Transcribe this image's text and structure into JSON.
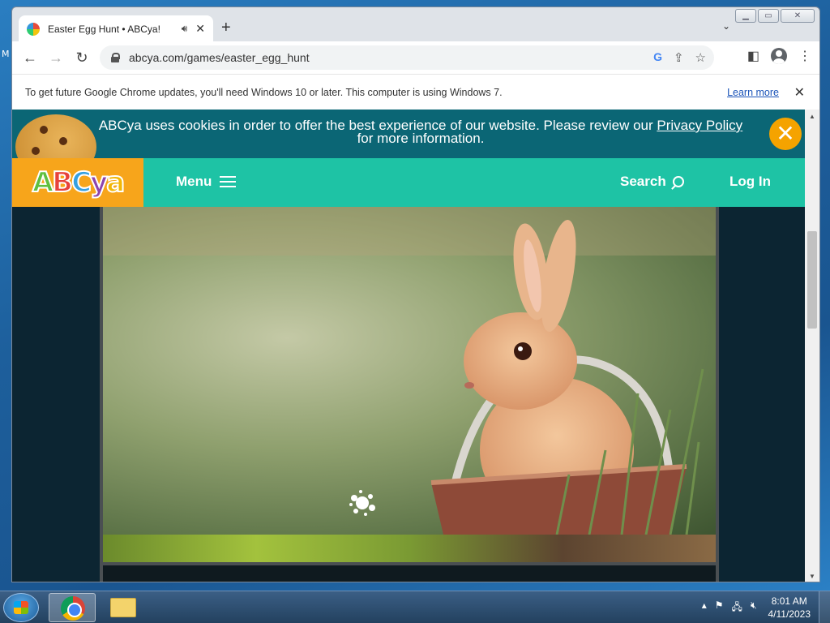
{
  "browser": {
    "tab_title": "Easter Egg Hunt • ABCya!",
    "url": "abcya.com/games/easter_egg_hunt",
    "infobar_text": "To get future Google Chrome updates, you'll need Windows 10 or later. This computer is using Windows 7.",
    "learn_more": "Learn more"
  },
  "site": {
    "cookie_text_1": "ABCya uses cookies in order to offer the best experience of our website. Please review our ",
    "cookie_link": "Privacy Policy",
    "cookie_text_2": "for more information.",
    "logo": [
      "A",
      "B",
      "C",
      "y",
      "a"
    ],
    "menu_label": "Menu",
    "search_label": "Search",
    "login_label": "Log In"
  },
  "taskbar": {
    "time": "8:01 AM",
    "date": "4/11/2023"
  },
  "colors": {
    "cookie_banner": "#0b6675",
    "header": "#1ec3a5",
    "logo_bg": "#f7a51b",
    "close_button": "#f5a300"
  }
}
